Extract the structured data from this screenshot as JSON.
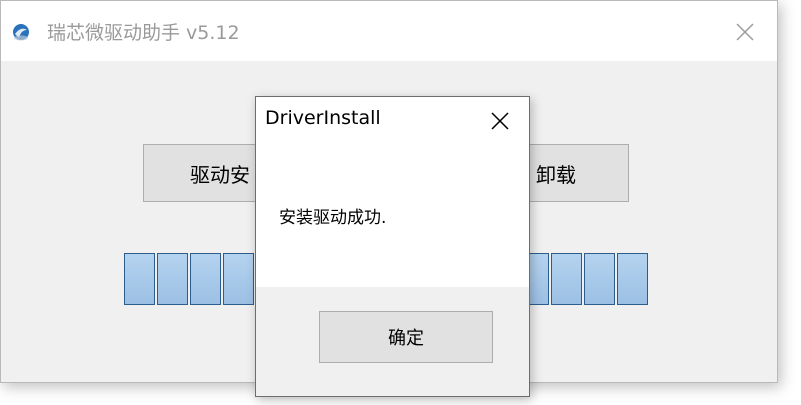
{
  "main_window": {
    "title": "瑞芯微驱动助手 v5.12",
    "install_button_label": "驱动安",
    "uninstall_button_label": "卸载",
    "progress_segments": 16,
    "progress_fraction": 1.0
  },
  "dialog": {
    "title": "DriverInstall",
    "message": "安装驱动成功.",
    "ok_label": "确定"
  },
  "icons": {
    "app": "app-icon",
    "main_close": "close-icon",
    "dialog_close": "close-icon"
  },
  "colors": {
    "progress_fill": "#a9cbed",
    "progress_border": "#2d5d8c",
    "button_face": "#e1e1e1"
  }
}
